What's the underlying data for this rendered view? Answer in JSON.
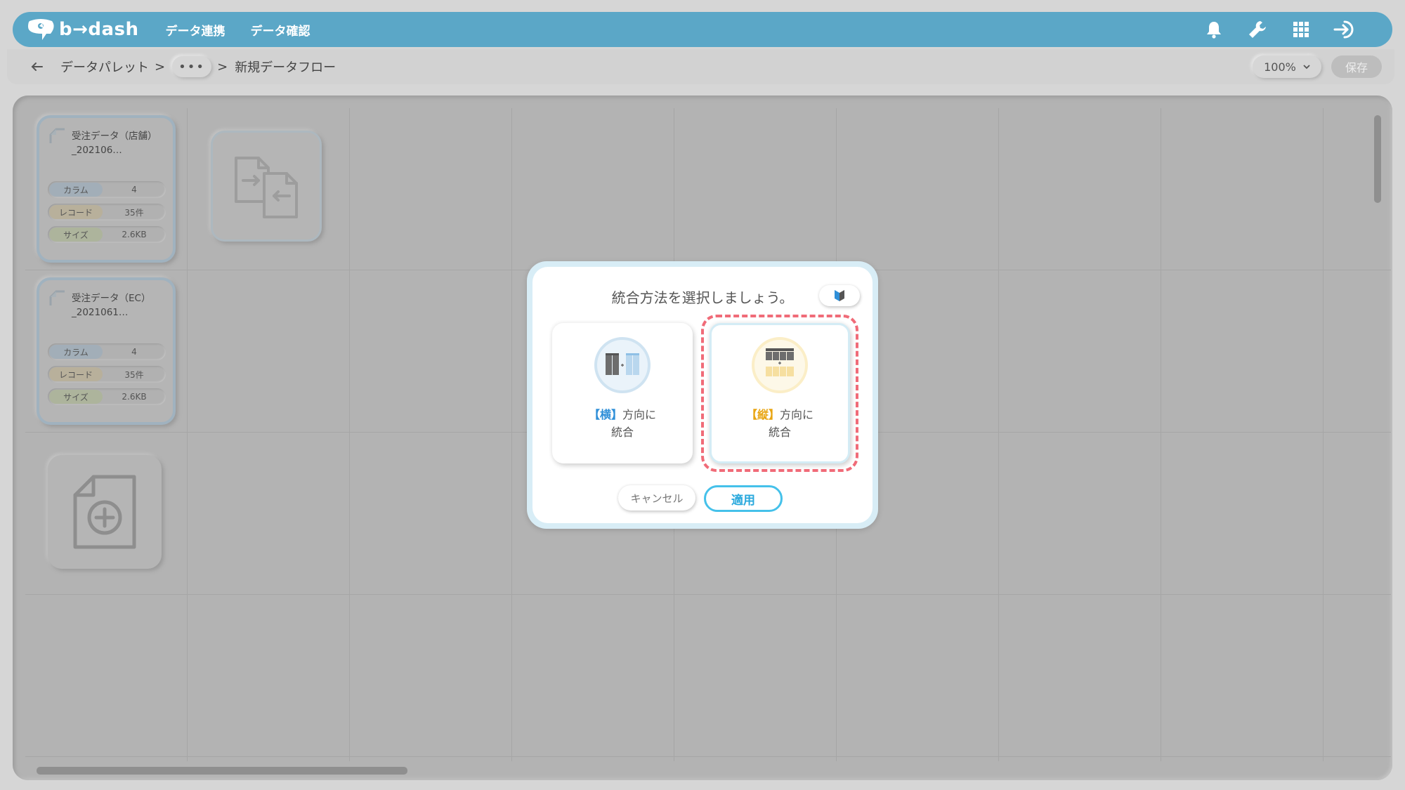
{
  "app": {
    "logo_text": "b→dash"
  },
  "nav": {
    "links": [
      "データ連携",
      "データ確認"
    ]
  },
  "breadcrumb": {
    "root": "データパレット",
    "sep": ">",
    "more": "•••",
    "current": "新規データフロー"
  },
  "toolbar": {
    "zoom": "100%",
    "save_label": "保存"
  },
  "cards": [
    {
      "title": "受注データ（店舗）_202106…",
      "stats": [
        {
          "label": "カラム",
          "value": "4"
        },
        {
          "label": "レコード",
          "value": "35件"
        },
        {
          "label": "サイズ",
          "value": "2.6KB"
        }
      ]
    },
    {
      "title": "受注データ（EC）_2021061…",
      "stats": [
        {
          "label": "カラム",
          "value": "4"
        },
        {
          "label": "レコード",
          "value": "35件"
        },
        {
          "label": "サイズ",
          "value": "2.6KB"
        }
      ]
    }
  ],
  "dialog": {
    "title": "統合方法を選択しましょう。",
    "options": [
      {
        "bracket": "【横】",
        "text1": "方向に",
        "text2": "統合"
      },
      {
        "bracket": "【縦】",
        "text1": "方向に",
        "text2": "統合"
      }
    ],
    "cancel_label": "キャンセル",
    "apply_label": "適用"
  },
  "colors": {
    "nav_bg": "#5ba7c7",
    "accent": "#45c1ea",
    "highlight": "#f06b78",
    "horizontal": "#2f8fd8",
    "vertical": "#e8a512"
  },
  "icons": [
    "logo-icon",
    "bell-icon",
    "wrench-icon",
    "grid-icon",
    "logout-icon",
    "back-arrow-icon",
    "chevron-down-icon",
    "merge-icon",
    "add-file-icon",
    "beginner-mark-icon"
  ]
}
